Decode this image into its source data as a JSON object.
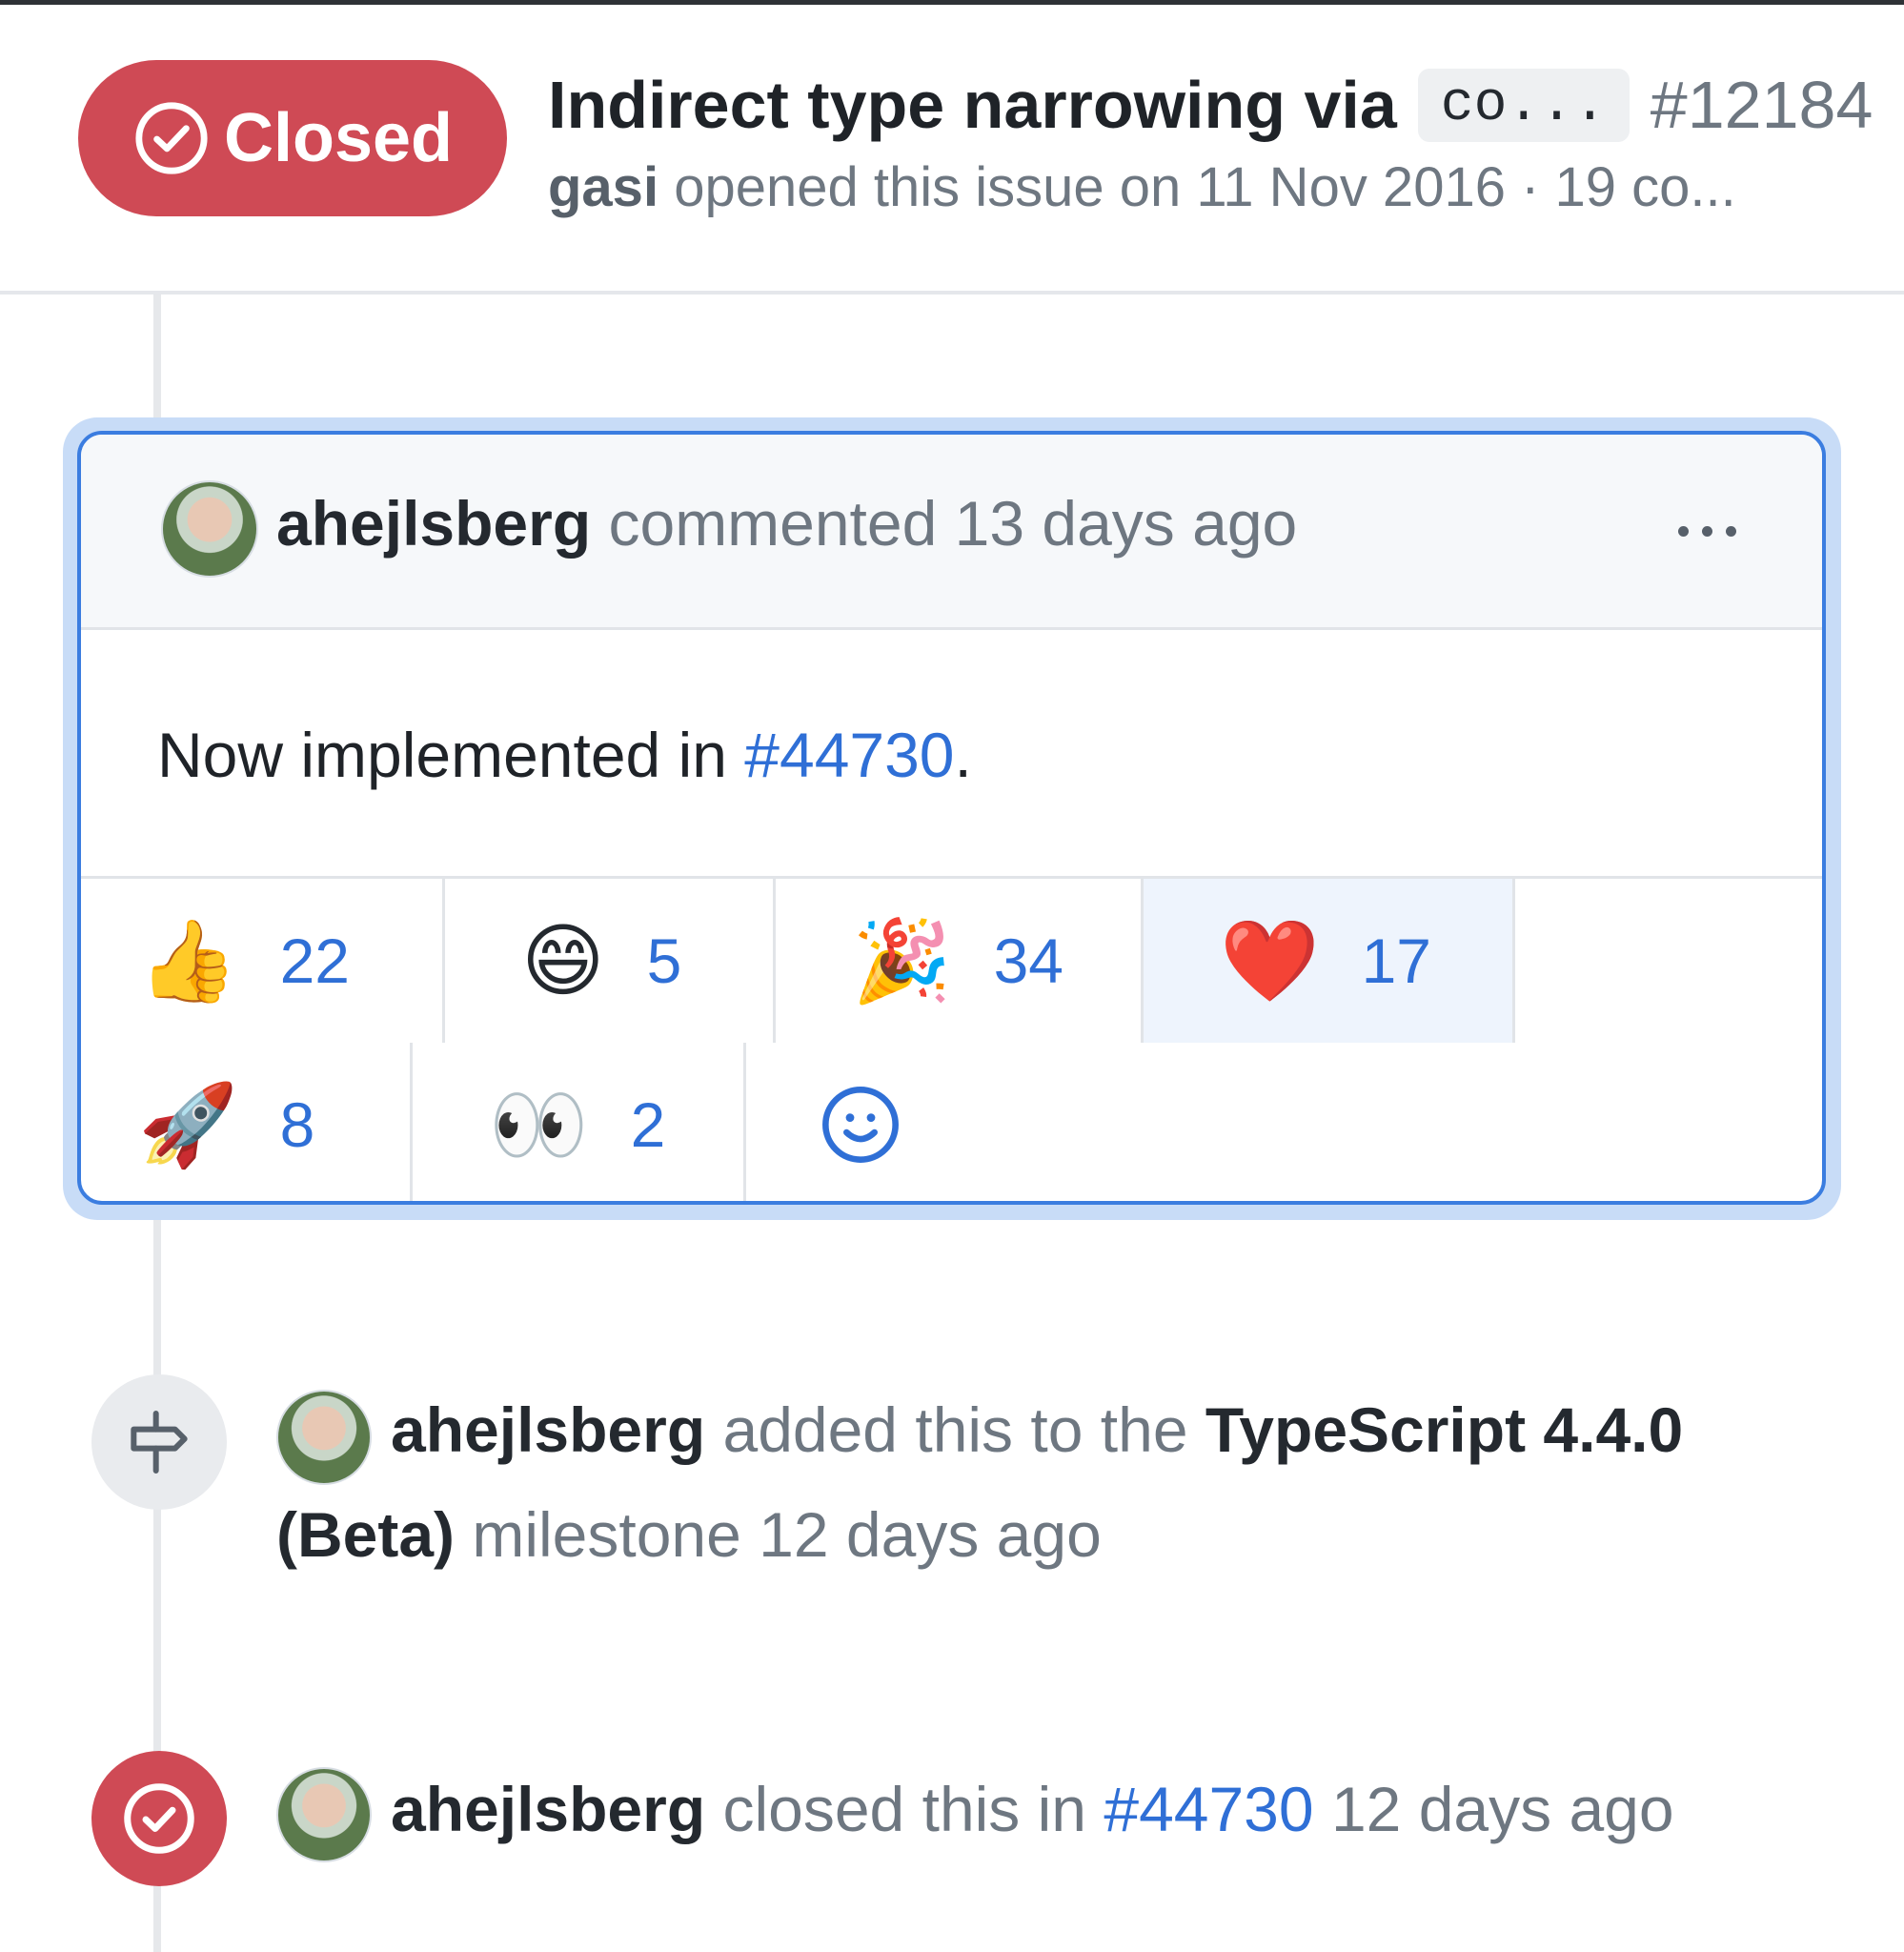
{
  "header": {
    "state_label": "Closed",
    "title": "Indirect type narrowing via",
    "title_code": "co...",
    "issue_number": "#12184",
    "opened_by": "gasi",
    "opened_text": "opened this issue on 11 Nov 2016 · 19 co..."
  },
  "comment": {
    "author": "ahejlsberg",
    "action": "commented 13 days ago",
    "body_prefix": "Now implemented in",
    "body_link": "#44730",
    "body_suffix": ".",
    "reactions": [
      {
        "emoji": "👍",
        "icon": "thumbs-up-icon",
        "count": "22"
      },
      {
        "emoji": "😄",
        "icon": "laugh-icon",
        "count": "5"
      },
      {
        "emoji": "🎉",
        "icon": "hooray-icon",
        "count": "34"
      },
      {
        "emoji": "❤️",
        "icon": "heart-icon",
        "count": "17"
      },
      {
        "emoji": "🚀",
        "icon": "rocket-icon",
        "count": "8"
      },
      {
        "emoji": "👀",
        "icon": "eyes-icon",
        "count": "2"
      }
    ]
  },
  "events": {
    "milestone": {
      "author": "ahejlsberg",
      "text": "added this to the",
      "milestone": "TypeScript 4.4.0 (Beta)",
      "suffix": "milestone 12 days ago"
    },
    "closed": {
      "author": "ahejlsberg",
      "text": "closed this in",
      "link": "#44730",
      "suffix": "12 days ago"
    }
  },
  "colors": {
    "closed_red": "#cf4a55",
    "link_blue": "#2f6fd6",
    "focus_blue": "#3b7de0"
  }
}
